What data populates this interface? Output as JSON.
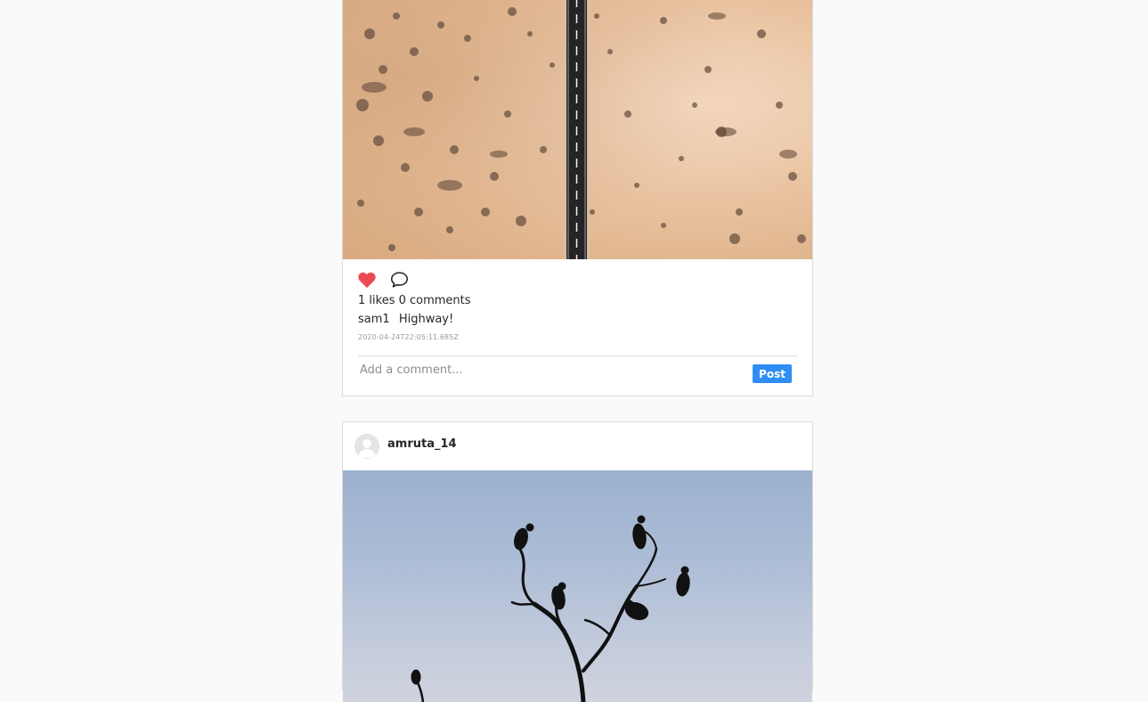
{
  "posts": [
    {
      "photo_alt": "Highway",
      "likes_text": "1 likes 0 comments",
      "username": "sam1",
      "caption": "Highway!",
      "timestamp": "2020-04-24T22:05:11.685Z",
      "comment_placeholder": "Add a comment...",
      "post_label": "Post",
      "icons": [
        "heart-icon",
        "comment-icon"
      ],
      "liked": true
    },
    {
      "username": "amruta_14",
      "avatar_icon": "default-avatar-icon"
    }
  ],
  "colors": {
    "like": "#ed4956",
    "accent": "#2f8ef4",
    "border": "#dbdbdb"
  }
}
